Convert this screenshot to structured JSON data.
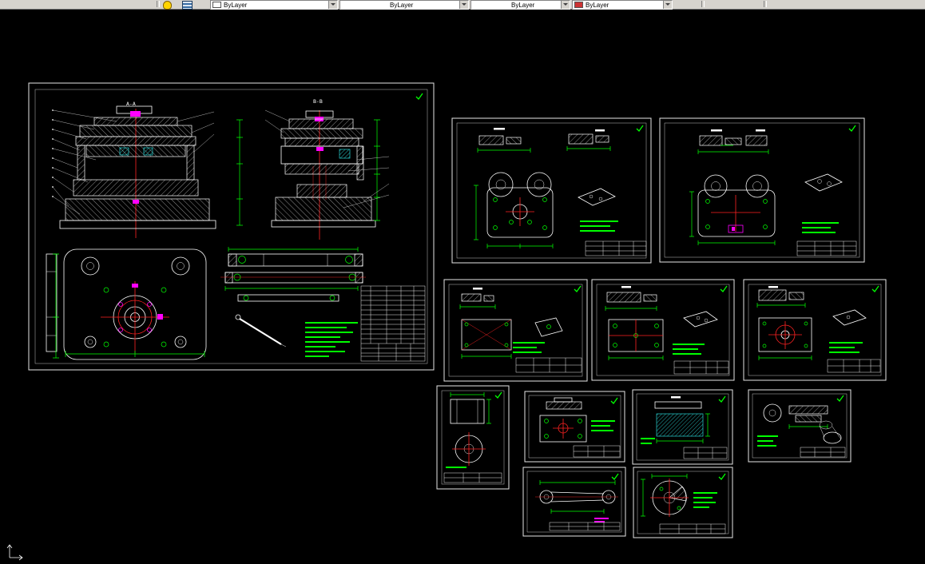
{
  "toolbar": {
    "layer_control": "ByLayer",
    "color_control": "ByLayer",
    "linetype_control": "ByLayer",
    "lineweight_control": "ByLayer"
  },
  "drawing": {
    "section_labels": {
      "a": "A-A",
      "b": "B-B"
    }
  },
  "palette": {
    "canvas_bg": "#000000",
    "toolbar_bg": "#d6d3ce",
    "outline": "#ffffff",
    "dimension": "#00ff00",
    "centerline": "#ff2222",
    "highlight": "#ff00ff",
    "hatch_alt": "#2ad4d4",
    "swatch_red": "#cc3333"
  }
}
